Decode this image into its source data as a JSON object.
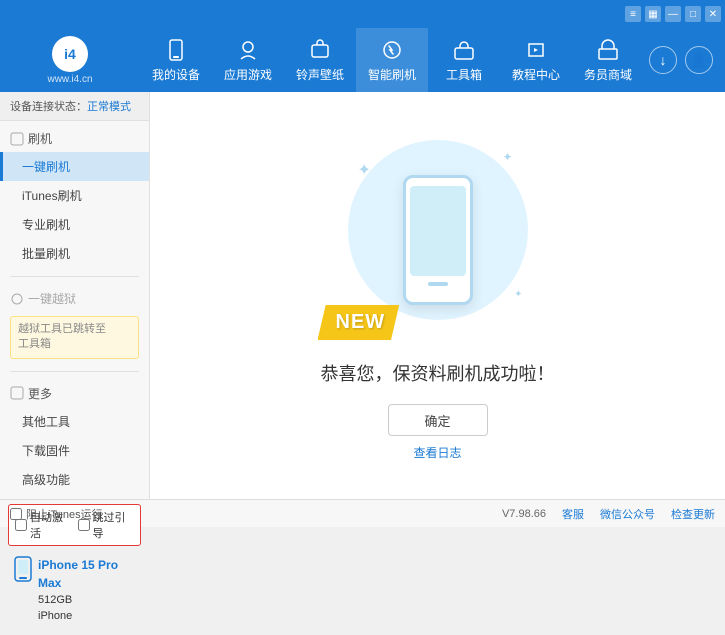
{
  "topbar": {
    "icons": [
      "wifi",
      "battery",
      "minimize",
      "maximize",
      "close"
    ]
  },
  "header": {
    "logo_text": "i4",
    "logo_subtitle": "www.i4.cn",
    "nav_items": [
      {
        "id": "my-device",
        "label": "我的设备",
        "icon": "📱"
      },
      {
        "id": "apps-games",
        "label": "应用游戏",
        "icon": "👤"
      },
      {
        "id": "ringtone",
        "label": "铃声壁纸",
        "icon": "🔔"
      },
      {
        "id": "smart-flash",
        "label": "智能刷机",
        "icon": "🔄",
        "active": true
      },
      {
        "id": "toolbox",
        "label": "工具箱",
        "icon": "🧰"
      },
      {
        "id": "tutorials",
        "label": "教程中心",
        "icon": "🎓"
      },
      {
        "id": "merchant",
        "label": "务员商域",
        "icon": "🏪"
      }
    ]
  },
  "sidebar": {
    "status_label": "设备连接状态：",
    "status_value": "正常模式",
    "section_flash": {
      "header": "刷机",
      "items": [
        {
          "id": "one-key-flash",
          "label": "一键刷机",
          "active": true
        },
        {
          "id": "itunes-flash",
          "label": "iTunes刷机"
        },
        {
          "id": "pro-flash",
          "label": "专业刷机"
        },
        {
          "id": "batch-flash",
          "label": "批量刷机"
        }
      ]
    },
    "section_onekey": {
      "header": "一键越狱",
      "disabled_label": "越狱工具已跳转至工具箱",
      "notice_text": "越狱工具已跳转至\n工具箱"
    },
    "section_more": {
      "header": "更多",
      "items": [
        {
          "id": "other-tools",
          "label": "其他工具"
        },
        {
          "id": "download-firmware",
          "label": "下载固件"
        },
        {
          "id": "advanced",
          "label": "高级功能"
        }
      ]
    },
    "auto_activate": "自动激活",
    "guide_activate": "跳过引导",
    "device": {
      "name": "iPhone 15 Pro Max",
      "storage": "512GB",
      "type": "iPhone"
    }
  },
  "content": {
    "new_badge": "NEW",
    "success_message": "恭喜您，保资料刷机成功啦！",
    "confirm_button": "确定",
    "log_link": "查看日志"
  },
  "footer": {
    "itunes_label": "阻止iTunes运行",
    "version": "V7.98.66",
    "client": "客服",
    "wechat": "微信公众号",
    "check_update": "检查更新"
  }
}
